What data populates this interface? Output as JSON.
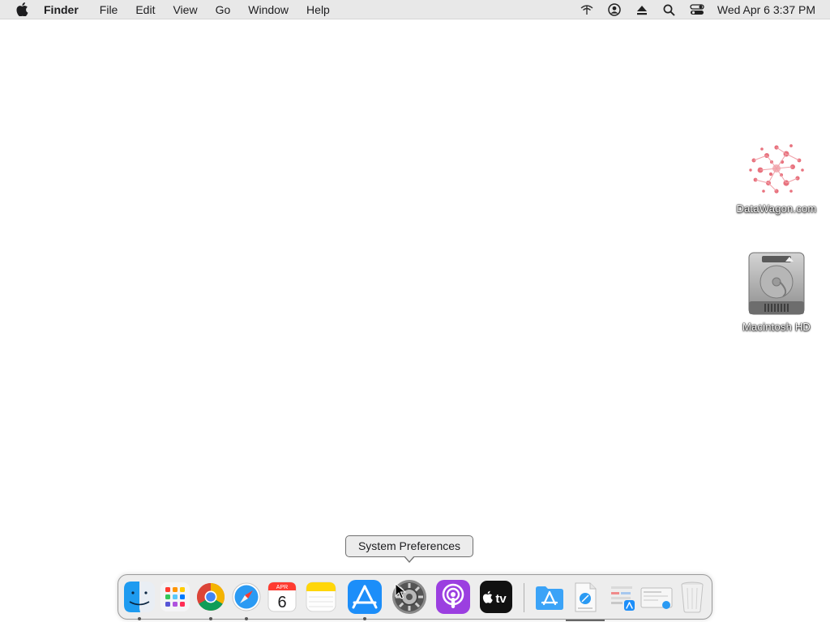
{
  "menubar": {
    "apple_icon": "apple-logo-icon",
    "app_name": "Finder",
    "items": [
      "File",
      "Edit",
      "View",
      "Go",
      "Window",
      "Help"
    ],
    "status_icons": [
      "wifi-icon",
      "user-account-icon",
      "eject-icon",
      "spotlight-search-icon",
      "control-center-icon"
    ],
    "clock": "Wed Apr 6  3:37 PM"
  },
  "desktop": {
    "icons": [
      {
        "label": "DataWagon.com",
        "icon": "datawagon-image-icon"
      },
      {
        "label": "Macintosh HD",
        "icon": "hard-drive-icon"
      }
    ]
  },
  "tooltip": {
    "text": "System Preferences"
  },
  "dock": {
    "items": [
      {
        "name": "Finder",
        "icon": "finder-icon",
        "running": true
      },
      {
        "name": "Launchpad",
        "icon": "launchpad-icon",
        "running": false
      },
      {
        "name": "Google Chrome",
        "icon": "chrome-icon",
        "running": true
      },
      {
        "name": "Safari",
        "icon": "safari-icon",
        "running": true
      },
      {
        "name": "Calendar",
        "icon": "calendar-icon",
        "running": false,
        "month": "APR",
        "day": "6"
      },
      {
        "name": "Notes",
        "icon": "notes-icon",
        "running": false
      },
      {
        "name": "App Store",
        "icon": "app-store-icon",
        "running": true
      },
      {
        "name": "System Preferences",
        "icon": "system-preferences-icon",
        "running": false
      },
      {
        "name": "Podcasts",
        "icon": "podcasts-icon",
        "running": false
      },
      {
        "name": "Apple TV",
        "icon": "apple-tv-icon",
        "running": false,
        "label": "tv"
      },
      {
        "name": "Applications",
        "icon": "applications-folder-icon",
        "running": false
      },
      {
        "name": "Downloads",
        "icon": "downloads-stack-icon",
        "running": false
      },
      {
        "name": "Recent Items",
        "icon": "recent-stack-icon",
        "running": false
      },
      {
        "name": "Documents",
        "icon": "documents-stack-icon",
        "running": false
      },
      {
        "name": "Trash",
        "icon": "trash-icon",
        "running": false
      }
    ]
  },
  "colors": {
    "menubar_bg": "#e8e8e8",
    "desktop_bg": "#ffffff",
    "dock_bg": "#ececec",
    "podcasts": "#9b3fe0",
    "app_store": "#1c8ef9"
  }
}
